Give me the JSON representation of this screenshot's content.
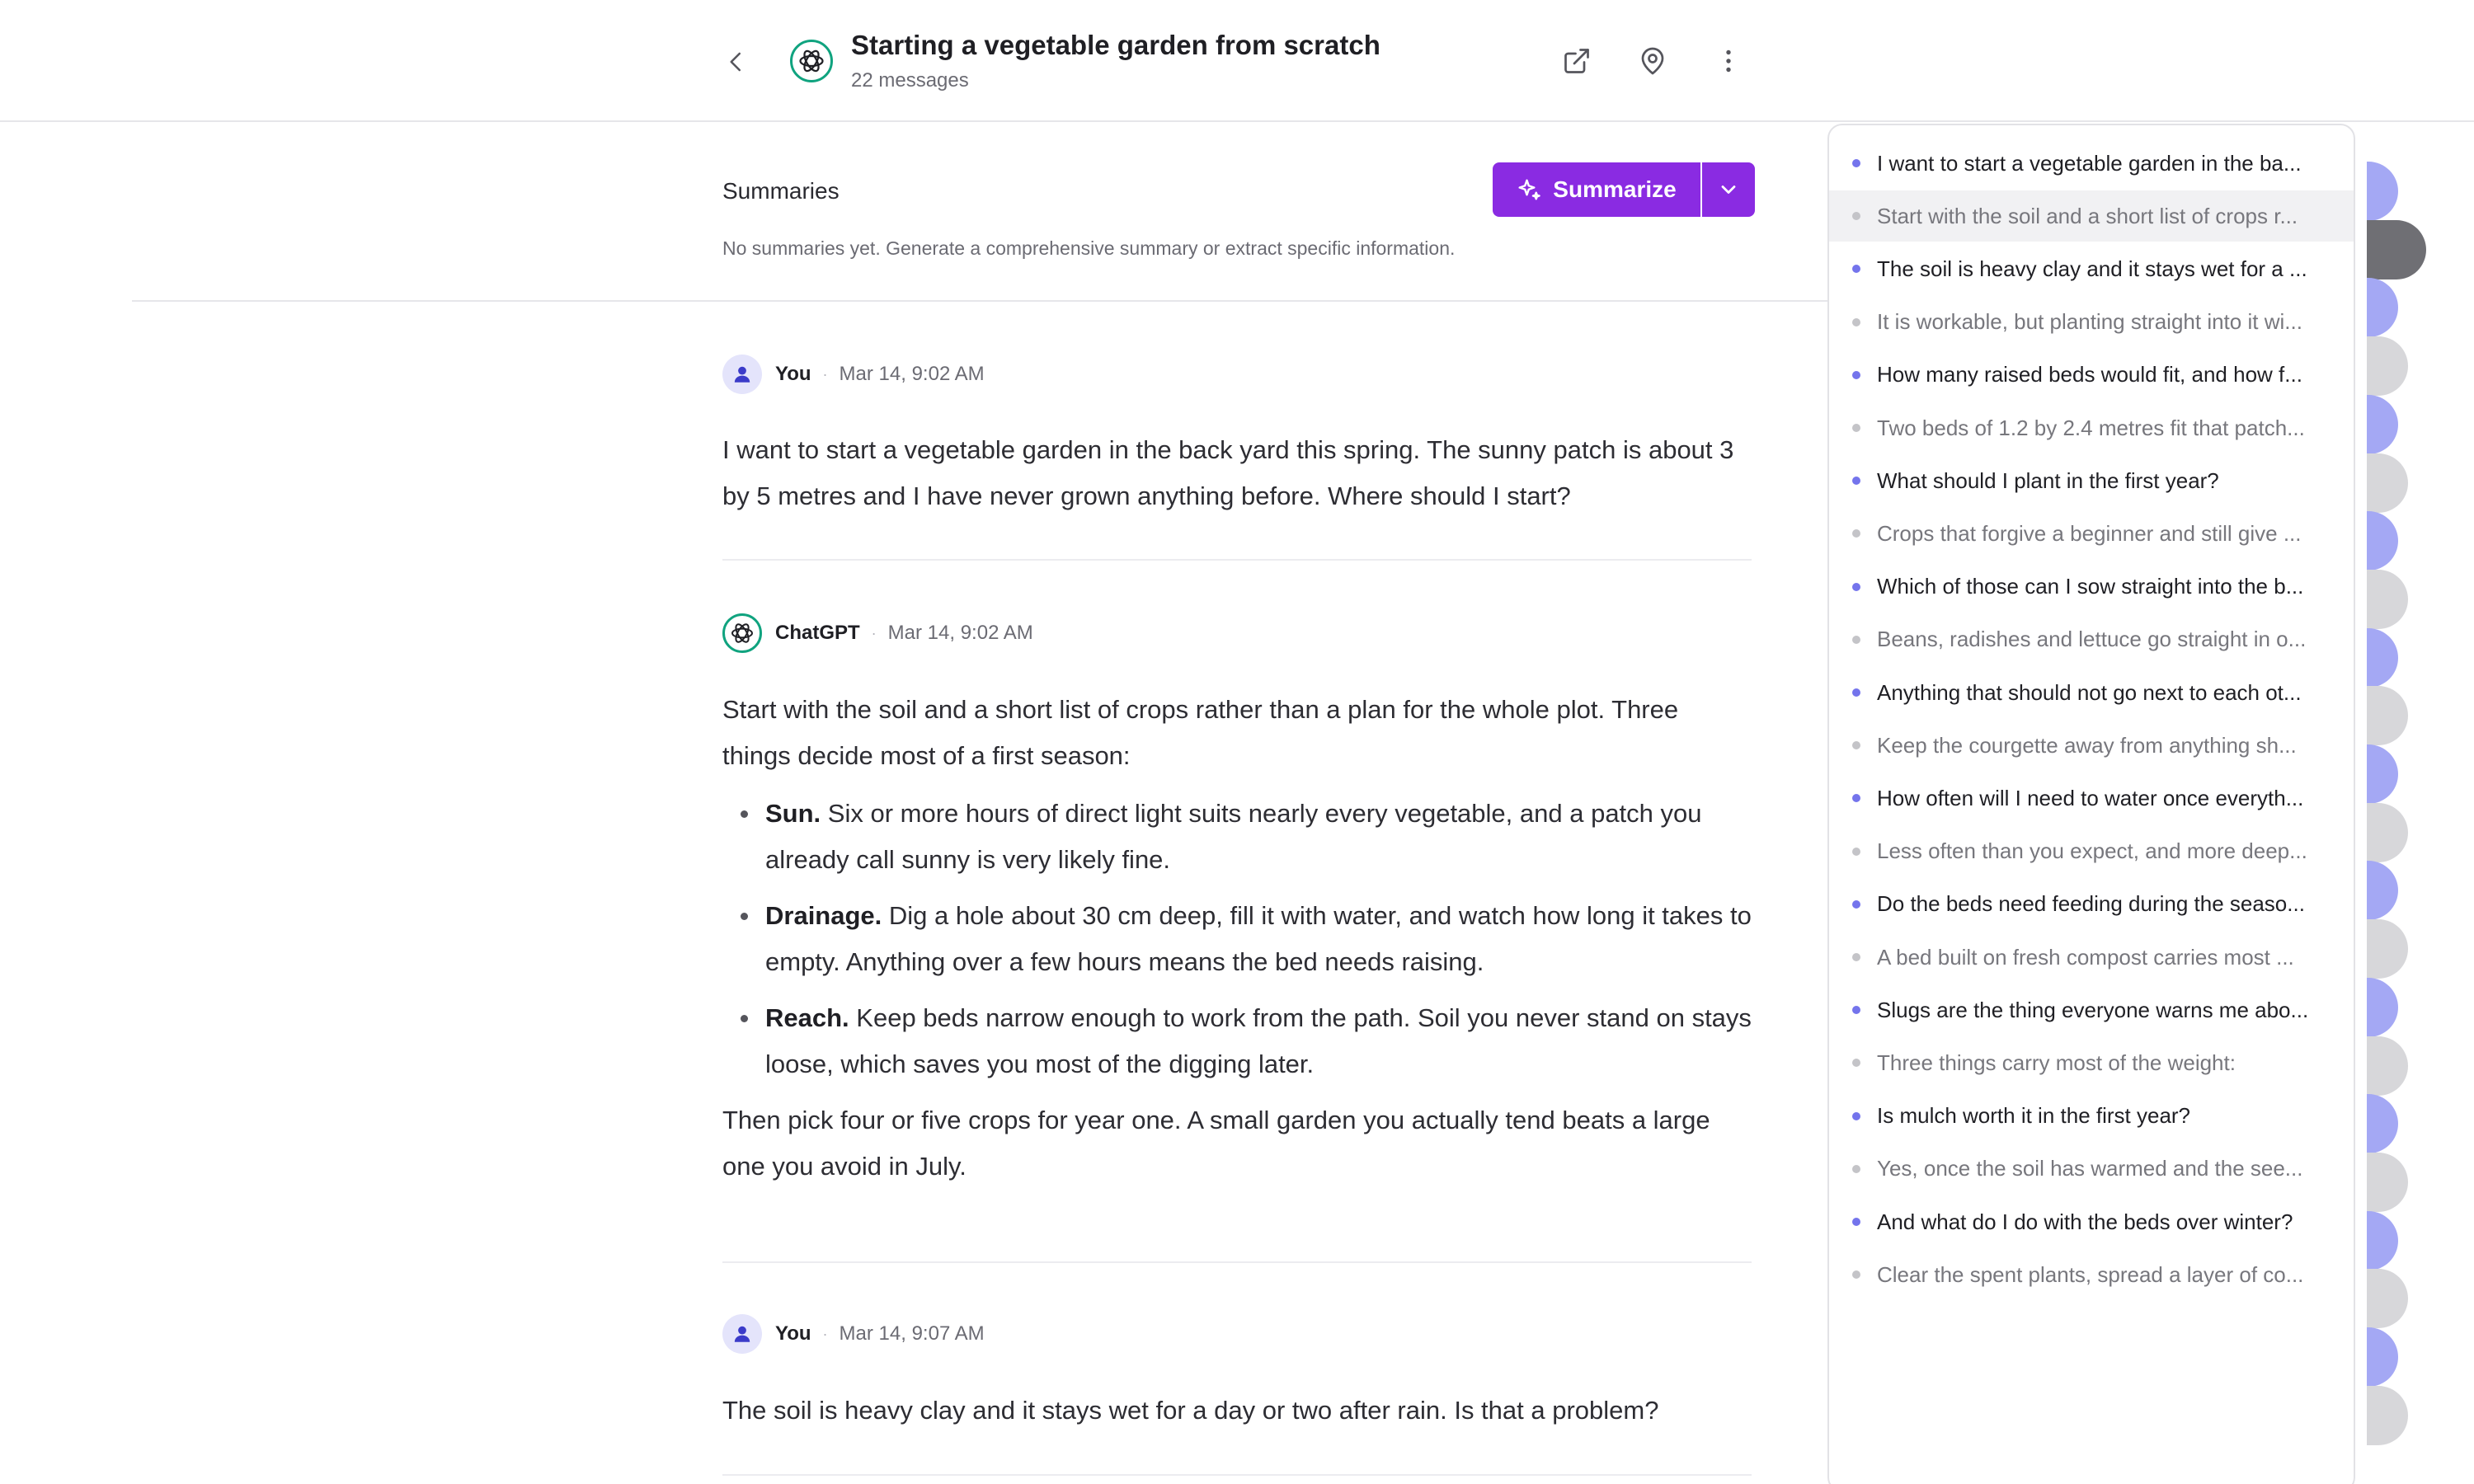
{
  "header": {
    "title": "Starting a vegetable garden from scratch",
    "count": "22 messages",
    "icons": [
      "chevron-left-icon",
      "chatgpt-logo",
      "external-link-icon",
      "location-pin-icon",
      "more-vertical-icon"
    ]
  },
  "summaries": {
    "title": "Summaries",
    "empty_text": "No summaries yet. Generate a comprehensive summary or extract specific information.",
    "button_label": "Summarize",
    "accent": "#8a2be2"
  },
  "messages": [
    {
      "author": "You",
      "time": "Mar 14, 9:02 AM",
      "text": "I want to start a vegetable garden in the back yard this spring. The sunny patch is about 3 by 5 metres and I have never grown anything before. Where should I start?"
    },
    {
      "author": "ChatGPT",
      "time": "Mar 14, 9:02 AM",
      "intro": "Start with the soil and a short list of crops rather than a plan for the whole plot. Three things decide most of a first season:",
      "bullets": [
        {
          "bold": "Sun.",
          "text": " Six or more hours of direct light suits nearly every vegetable, and a patch you already call sunny is very likely fine."
        },
        {
          "bold": "Drainage.",
          "text": " Dig a hole about 30 cm deep, fill it with water, and watch how long it takes to empty. Anything over a few hours means the bed needs raising."
        },
        {
          "bold": "Reach.",
          "text": " Keep beds narrow enough to work from the path. Soil you never stand on stays loose, which saves you most of the digging later."
        }
      ],
      "outro": "Then pick four or five crops for year one. A small garden you actually tend beats a large one you avoid in July."
    },
    {
      "author": "You",
      "time": "Mar 14, 9:07 AM",
      "text": "The soil is heavy clay and it stays wet for a day or two after rain. Is that a problem?"
    }
  ],
  "outline": [
    {
      "role": "user",
      "text": "I want to start a vegetable garden in the ba..."
    },
    {
      "role": "ai",
      "text": "Start with the soil and a short list of crops r..."
    },
    {
      "role": "user",
      "text": "The soil is heavy clay and it stays wet for a ..."
    },
    {
      "role": "ai",
      "text": "It is workable, but planting straight into it wi..."
    },
    {
      "role": "user",
      "text": "How many raised beds would fit, and how f..."
    },
    {
      "role": "ai",
      "text": "Two beds of 1.2 by 2.4 metres fit that patch..."
    },
    {
      "role": "user",
      "text": "What should I plant in the first year?"
    },
    {
      "role": "ai",
      "text": "Crops that forgive a beginner and still give ..."
    },
    {
      "role": "user",
      "text": "Which of those can I sow straight into the b..."
    },
    {
      "role": "ai",
      "text": "Beans, radishes and lettuce go straight in o..."
    },
    {
      "role": "user",
      "text": "Anything that should not go next to each ot..."
    },
    {
      "role": "ai",
      "text": "Keep the courgette away from anything sh..."
    },
    {
      "role": "user",
      "text": "How often will I need to water once everyth..."
    },
    {
      "role": "ai",
      "text": "Less often than you expect, and more deep..."
    },
    {
      "role": "user",
      "text": "Do the beds need feeding during the seaso..."
    },
    {
      "role": "ai",
      "text": "A bed built on fresh compost carries most ..."
    },
    {
      "role": "user",
      "text": "Slugs are the thing everyone warns me abo..."
    },
    {
      "role": "ai",
      "text": "Three things carry most of the weight:"
    },
    {
      "role": "user",
      "text": "Is mulch worth it in the first year?"
    },
    {
      "role": "ai",
      "text": "Yes, once the soil has warmed and the see..."
    },
    {
      "role": "user",
      "text": "And what do I do with the beds over winter?"
    },
    {
      "role": "ai",
      "text": "Clear the spent plants, spread a layer of co..."
    }
  ],
  "outline_active_index": 1,
  "colors": {
    "user_dot": "#7474ec",
    "ai_dot": "#c4c4c8",
    "minimap_user": "#a4a8f4",
    "minimap_ai": "#d7d7da",
    "minimap_current": "#6f6f74",
    "chatgpt_green": "#10a37f"
  }
}
